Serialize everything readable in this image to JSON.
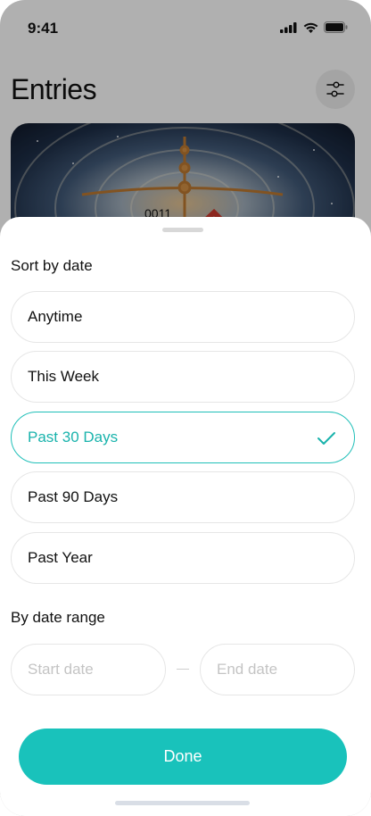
{
  "status_bar": {
    "time": "9:41"
  },
  "header": {
    "title": "Entries"
  },
  "entry_card": {
    "code": "0011"
  },
  "sheet": {
    "sort_title": "Sort by date",
    "options": [
      {
        "label": "Anytime",
        "selected": false
      },
      {
        "label": "This Week",
        "selected": false
      },
      {
        "label": "Past 30 Days",
        "selected": true
      },
      {
        "label": "Past 90 Days",
        "selected": false
      },
      {
        "label": "Past Year",
        "selected": false
      }
    ],
    "range_title": "By date range",
    "start_placeholder": "Start date",
    "end_placeholder": "End date",
    "done_label": "Done"
  },
  "colors": {
    "accent": "#19c2bb",
    "selected_text": "#19b3ac"
  }
}
